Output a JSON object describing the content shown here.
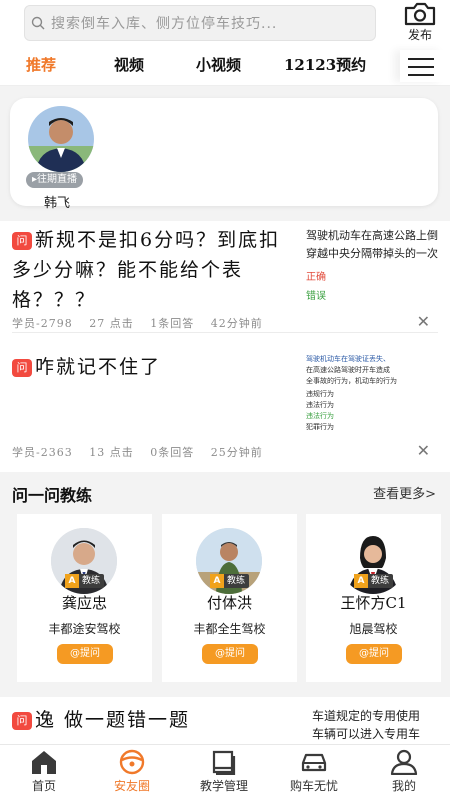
{
  "search": {
    "placeholder": "搜索倒车入库、侧方位停车技巧..."
  },
  "publish_label": "发布",
  "tabs": [
    {
      "label": "推荐",
      "active": true
    },
    {
      "label": "视频",
      "active": false
    },
    {
      "label": "小视频",
      "active": false
    },
    {
      "label": "12123预约",
      "active": false
    }
  ],
  "live": {
    "badge": "往期直播",
    "name": "韩飞"
  },
  "questions": [
    {
      "tag": "问",
      "title": "新规不是扣6分吗？到底扣多少分嘛？能不能给个表格？？？",
      "user": "学员-2798",
      "views": "27 点击",
      "answers": "1条回答",
      "time": "42分钟前",
      "thumb_lines": [
        "驾驶机动车在高速公路上倒",
        "穿越中央分隔带掉头的一次"
      ],
      "thumb_opts": [
        "正确",
        "错误"
      ]
    },
    {
      "tag": "问",
      "title": "咋就记不住了",
      "user": "学员-2363",
      "views": "13 点击",
      "answers": "0条回答",
      "time": "25分钟前",
      "thumb_lines": [
        "驾驶机动车在驾驶证丢失、",
        "在高速公路驾驶时开车造成",
        "全事故的行为，机动车的行为"
      ],
      "thumb_opts": [
        "违规行为",
        "违法行为",
        "违法行为",
        "犯罪行为"
      ]
    }
  ],
  "ask": {
    "title": "问一问教练",
    "more": "查看更多>",
    "badge_letter": "A",
    "badge_text": "教练",
    "button": "@提问",
    "teachers": [
      {
        "name": "龚应忠",
        "school": "丰都途安驾校"
      },
      {
        "name": "付体洪",
        "school": "丰都全生驾校"
      },
      {
        "name": "王怀方C1",
        "school": "旭晨驾校"
      }
    ]
  },
  "bottom_question": {
    "tag": "问",
    "title": "逸 做一题错一题",
    "thumb_lines": [
      "车道规定的专用使用",
      "车辆可以进入专用车"
    ]
  },
  "nav": [
    {
      "label": "首页",
      "active": false
    },
    {
      "label": "安友圈",
      "active": true
    },
    {
      "label": "教学管理",
      "active": false
    },
    {
      "label": "购车无忧",
      "active": false
    },
    {
      "label": "我的",
      "active": false
    }
  ],
  "colors": {
    "accent": "#f0792a",
    "tag_red": "#f24a3f",
    "ask_button": "#f59a23"
  }
}
